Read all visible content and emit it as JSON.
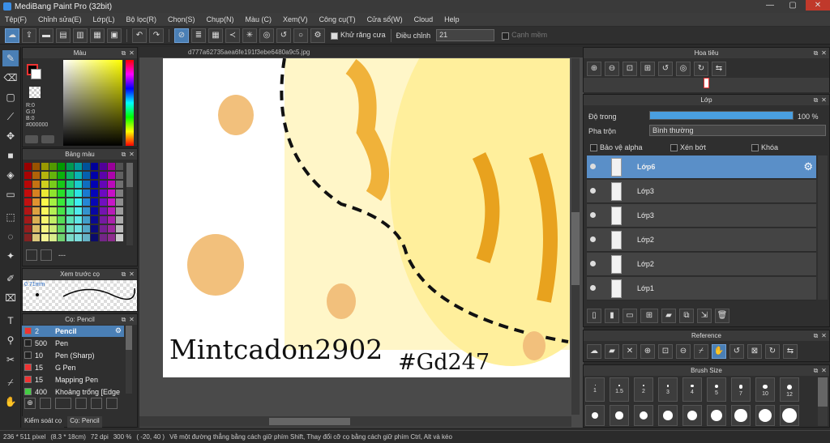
{
  "title": "MediBang Paint Pro (32bit)",
  "menu": [
    "Tệp(F)",
    "Chỉnh sửa(E)",
    "Lớp(L)",
    "Bộ lọc(R)",
    "Chọn(S)",
    "Chụp(N)",
    "Màu (C)",
    "Xem(V)",
    "Công cụ(T)",
    "Cửa sổ(W)",
    "Cloud",
    "Help"
  ],
  "toolbar": {
    "antialias": "Khử răng cưa",
    "adjust_label": "Điều chỉnh",
    "adjust_value": "21",
    "edge": "Cạnh mềm"
  },
  "color_panel": {
    "title": "Màu",
    "r": "R:0",
    "g": "G:0",
    "b": "B:0",
    "hex": "#000000"
  },
  "palette_panel": {
    "title": "Bảng màu",
    "footer": "---"
  },
  "preview_panel": {
    "title": "Xem trước cọ",
    "size": "0.71mm"
  },
  "brush_panel": {
    "title": "Cọ: Pencil",
    "items": [
      {
        "size": "2",
        "name": "Pencil",
        "color": "#e33",
        "active": true
      },
      {
        "size": "500",
        "name": "Pen",
        "color": "#222"
      },
      {
        "size": "10",
        "name": "Pen (Sharp)",
        "color": "#222"
      },
      {
        "size": "15",
        "name": "G Pen",
        "color": "#e33"
      },
      {
        "size": "15",
        "name": "Mapping Pen",
        "color": "#e33"
      },
      {
        "size": "400",
        "name": "Khoảng trống [Edge",
        "color": "#4c4"
      }
    ],
    "tab1": "Kiểm soát cọ",
    "tab2": "Cọ: Pencil"
  },
  "doc_tab": "d777a62735aea6fe191f3ebe6480a9c5.jpg",
  "doc_text": "Mintcadon2902",
  "doc_text2": "#Gd247",
  "navigator": {
    "title": "Hoa tiêu"
  },
  "layer_panel": {
    "title": "Lớp",
    "opacity_label": "Độ trong",
    "opacity_value": "100 %",
    "opacity_fraction": 1.0,
    "blend_label": "Pha trộn",
    "blend_value": "Bình thường",
    "protect_alpha": "Bảo vệ alpha",
    "clipping": "Xén bớt",
    "lock": "Khóa",
    "layers": [
      "Lớp6",
      "Lớp3",
      "Lớp3",
      "Lớp2",
      "Lớp2",
      "Lớp1"
    ]
  },
  "reference_panel": {
    "title": "Reference"
  },
  "brushsize_panel": {
    "title": "Brush Size",
    "sizes": [
      "1",
      "1.5",
      "2",
      "3",
      "4",
      "5",
      "7",
      "10",
      "12"
    ]
  },
  "status": {
    "size": "236 * 511 pixel",
    "cm": "(8.3 * 18cm)",
    "dpi": "72 dpi",
    "zoom": "300 %",
    "coords": "( -20, 40 )",
    "hint": "Vẽ một đường thẳng bằng cách giữ phím Shift, Thay đổi cỡ cọ bằng cách giữ phím Ctrl, Alt và kéo"
  },
  "window_controls": {
    "minimize": "—",
    "maximize": "▢",
    "close": "✕"
  }
}
